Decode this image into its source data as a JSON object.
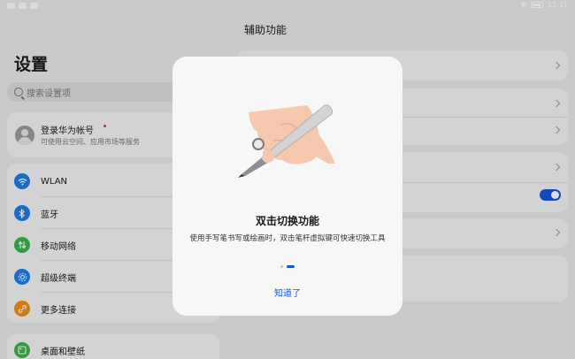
{
  "statusbar": {
    "time": "12:31"
  },
  "settings": {
    "title": "设置",
    "search_placeholder": "搜索设置项",
    "account": {
      "title": "登录华为帐号",
      "subtitle": "可使用云空间、应用市场等服务"
    },
    "network_items": [
      {
        "label": "WLAN",
        "icon": "wifi-icon",
        "color": "#1f7be6"
      },
      {
        "label": "蓝牙",
        "icon": "bluetooth-icon",
        "color": "#1f7be6"
      },
      {
        "label": "移动网络",
        "icon": "mobile-network-icon",
        "color": "#3bb34a"
      },
      {
        "label": "超级终端",
        "icon": "super-device-icon",
        "color": "#1f7be6"
      },
      {
        "label": "更多连接",
        "icon": "more-connections-icon",
        "color": "#f08c18"
      }
    ],
    "desktop_item": {
      "label": "桌面和壁纸",
      "icon": "desktop-icon",
      "color": "#3bb34a"
    }
  },
  "accessibility": {
    "title": "辅助功能",
    "toggle_on": true
  },
  "dialog": {
    "title": "双击切换功能",
    "description": "使用手写笔书写或绘画时，双击笔杆虚拟键可快速切换工具",
    "page_index": 2,
    "page_count": 2,
    "confirm_label": "知道了",
    "accent": "#1556d4"
  }
}
